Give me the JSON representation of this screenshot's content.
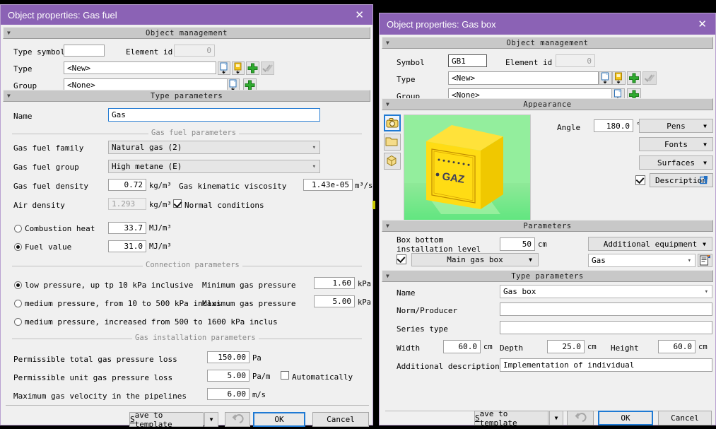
{
  "left_dialog": {
    "title": "Object properties: Gas fuel",
    "close_icon": "close-icon",
    "object_management": {
      "caption": "Object management",
      "type_symbol_label": "Type symbol",
      "type_symbol_value": "",
      "element_id_label": "Element id",
      "element_id_value": "0",
      "type_label": "Type",
      "type_value": "<New>",
      "group_label": "Group",
      "group_value": "<None>"
    },
    "type_parameters": {
      "caption": "Type parameters",
      "name_label": "Name",
      "name_value": "Gas",
      "gas_fuel_group_caption": "Gas fuel parameters",
      "gas_fuel_family_label": "Gas fuel family",
      "gas_fuel_family_value": "Natural gas (2)",
      "gas_fuel_group_label": "Gas fuel group",
      "gas_fuel_group_value": "High metane (E)",
      "gas_fuel_density_label": "Gas fuel density",
      "gas_fuel_density_value": "0.72",
      "gas_fuel_density_unit": "kg/m³",
      "gas_kinematic_viscosity_label": "Gas kinematic viscosity",
      "gas_kinematic_viscosity_value": "1.43e-05",
      "gas_kinematic_viscosity_unit": "m³/s",
      "air_density_label": "Air density",
      "air_density_value": "1.293",
      "air_density_unit": "kg/m³",
      "normal_conditions_label": "Normal conditions",
      "normal_conditions_checked": true,
      "combustion_heat_label": "Combustion heat",
      "combustion_heat_value": "33.7",
      "combustion_heat_unit": "MJ/m³",
      "combustion_heat_selected": false,
      "fuel_value_label": "Fuel value",
      "fuel_value_value": "31.0",
      "fuel_value_unit": "MJ/m³",
      "fuel_value_selected": true
    },
    "connection_parameters": {
      "caption": "Connection parameters",
      "options": [
        {
          "label": "low pressure, up tp 10 kPa inclusive",
          "selected": true
        },
        {
          "label": "medium pressure, from 10 to 500 kPa inclus",
          "selected": false
        },
        {
          "label": "medium pressure, increased from 500 to 1600 kPa inclus",
          "selected": false
        }
      ],
      "min_pressure_label": "Minimum gas pressure",
      "min_pressure_value": "1.60",
      "min_pressure_unit": "kPa",
      "max_pressure_label": "Maximum gas pressure",
      "max_pressure_value": "5.00",
      "max_pressure_unit": "kPa"
    },
    "gas_installation_parameters": {
      "caption": "Gas installation parameters",
      "total_loss_label": "Permissible total gas pressure loss",
      "total_loss_value": "150.00",
      "total_loss_unit": "Pa",
      "unit_loss_label": "Permissible unit gas pressure loss",
      "unit_loss_value": "5.00",
      "unit_loss_unit": "Pa/m",
      "automatically_label": "Automatically",
      "automatically_checked": false,
      "max_velocity_label": "Maximum gas velocity in the pipelines",
      "max_velocity_value": "6.00",
      "max_velocity_unit": "m/s"
    },
    "footer": {
      "save_to_template": "Save to template",
      "save_dropdown_icon": "chevron-down-icon",
      "undo_icon": "undo-icon",
      "ok": "OK",
      "cancel": "Cancel"
    }
  },
  "right_dialog": {
    "title": "Object properties: Gas box",
    "close_icon": "close-icon",
    "object_management": {
      "caption": "Object management",
      "symbol_label": "Symbol",
      "symbol_value": "GB1",
      "element_id_label": "Element id",
      "element_id_value": "0",
      "type_label": "Type",
      "type_value": "<New>",
      "group_label": "Group",
      "group_value": "<None>"
    },
    "appearance": {
      "caption": "Appearance",
      "view_tabs": [
        "camera-icon",
        "folder-icon",
        "cube-icon"
      ],
      "preview_label": "GAZ",
      "angle_label": "Angle",
      "angle_value": "180.0",
      "angle_unit": "°",
      "pens_button": "Pens",
      "fonts_button": "Fonts",
      "surfaces_button": "Surfaces",
      "description_button": "Description",
      "description_checked": true
    },
    "parameters": {
      "caption": "Parameters",
      "box_bottom_label_line1": "Box bottom",
      "box_bottom_label_line2": "installation level",
      "box_bottom_value": "50",
      "box_bottom_unit": "cm",
      "main_gas_box_checked": true,
      "main_gas_box_button": "Main gas box",
      "additional_equipment_button": "Additional equipment",
      "gas_select_value": "Gas",
      "edit_icon": "properties-icon"
    },
    "type_parameters": {
      "caption": "Type parameters",
      "name_label": "Name",
      "name_value": "Gas box",
      "norm_producer_label": "Norm/Producer",
      "norm_producer_value": "",
      "series_type_label": "Series type",
      "series_type_value": "",
      "width_label": "Width",
      "width_value": "60.0",
      "width_unit": "cm",
      "depth_label": "Depth",
      "depth_value": "25.0",
      "depth_unit": "cm",
      "height_label": "Height",
      "height_value": "60.0",
      "height_unit": "cm",
      "additional_description_label": "Additional description",
      "additional_description_value": "Implementation of individual"
    },
    "footer": {
      "save_to_template": "Save to template",
      "save_dropdown_icon": "chevron-down-icon",
      "undo_icon": "undo-icon",
      "ok": "OK",
      "cancel": "Cancel"
    }
  },
  "colors": {
    "titlebar": "#8b62b5",
    "dialog_bg": "#f0f0f0",
    "section_header": "#c8c8c8",
    "focus_border": "#1f7ad4",
    "accent_green": "#2faa2f",
    "marker_yellow": "#c8c800"
  }
}
